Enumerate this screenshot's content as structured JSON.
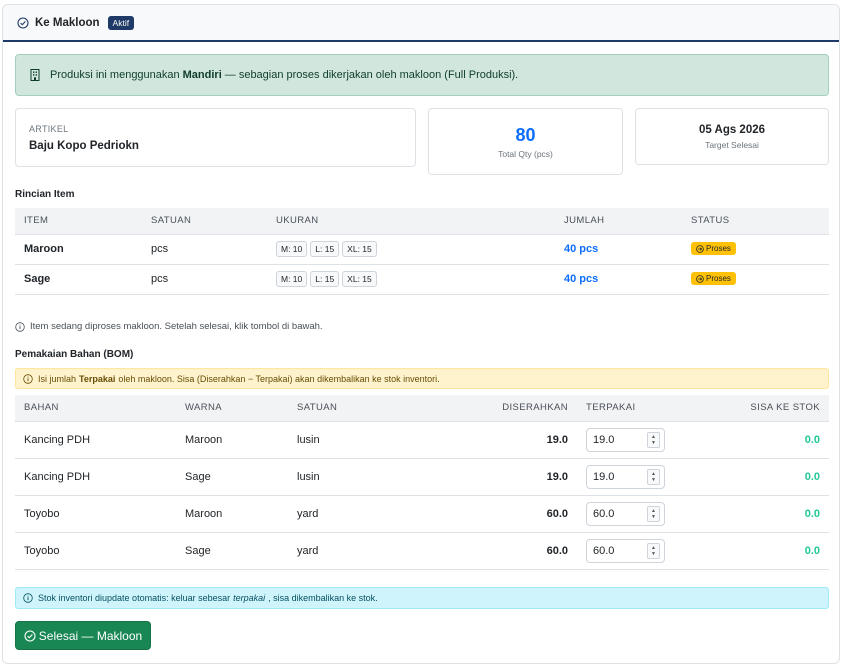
{
  "header": {
    "title": "Ke Makloon",
    "badge": "Aktif"
  },
  "production_alert": {
    "prefix": "Produksi ini menggunakan",
    "method": "Mandiri",
    "suffix": "— sebagian proses dikerjakan oleh makloon (Full Produksi)."
  },
  "artikel": {
    "label": "ARTIKEL",
    "name": "Baju Kopo Pedriokn"
  },
  "total_qty": {
    "value": "80",
    "label": "Total Qty (pcs)"
  },
  "target": {
    "date": "05 Ags 2026",
    "label": "Target Selesai"
  },
  "items_section": {
    "title": "Rincian Item",
    "columns": [
      "ITEM",
      "SATUAN",
      "UKURAN",
      "JUMLAH",
      "STATUS"
    ],
    "rows": [
      {
        "item": "Maroon",
        "satuan": "pcs",
        "sizes": [
          "M: 10",
          "L: 15",
          "XL: 15"
        ],
        "jumlah": "40 pcs",
        "status": "Proses"
      },
      {
        "item": "Sage",
        "satuan": "pcs",
        "sizes": [
          "M: 10",
          "L: 15",
          "XL: 15"
        ],
        "jumlah": "40 pcs",
        "status": "Proses"
      }
    ]
  },
  "process_note": "Item sedang diproses makloon. Setelah selesai, klik tombol di bawah.",
  "bom_section": {
    "title": "Pemakaian Bahan (BOM)",
    "alert_prefix": "Isi jumlah",
    "alert_bold": "Terpakai",
    "alert_suffix": "oleh makloon. Sisa (Diserahkan − Terpakai) akan dikembalikan ke stok inventori.",
    "columns": [
      "BAHAN",
      "WARNA",
      "SATUAN",
      "DISERAHKAN",
      "TERPAKAI",
      "SISA KE STOK"
    ],
    "rows": [
      {
        "bahan": "Kancing PDH",
        "warna": "Maroon",
        "satuan": "lusin",
        "diserahkan": "19.0",
        "terpakai": "19.0",
        "sisa": "0.0"
      },
      {
        "bahan": "Kancing PDH",
        "warna": "Sage",
        "satuan": "lusin",
        "diserahkan": "19.0",
        "terpakai": "19.0",
        "sisa": "0.0"
      },
      {
        "bahan": "Toyobo",
        "warna": "Maroon",
        "satuan": "yard",
        "diserahkan": "60.0",
        "terpakai": "60.0",
        "sisa": "0.0"
      },
      {
        "bahan": "Toyobo",
        "warna": "Sage",
        "satuan": "yard",
        "diserahkan": "60.0",
        "terpakai": "60.0",
        "sisa": "0.0"
      }
    ]
  },
  "stock_note": {
    "prefix": "Stok inventori diupdate otomatis: keluar sebesar",
    "italic": "terpakai",
    "suffix": ", sisa dikembalikan ke stok."
  },
  "done_button": "Selesai — Makloon",
  "colors": {
    "primary": "#0d6efd",
    "success": "#198754",
    "warning": "#ffc107",
    "teal": "#20c997",
    "navy": "#1f3a66"
  }
}
